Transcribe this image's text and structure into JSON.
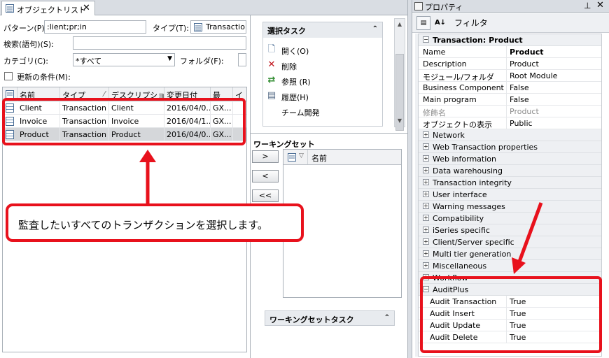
{
  "object_list": {
    "tab_title": "オブジェクトリスト",
    "tab_close": "✕",
    "pattern_label": "パターン(P):",
    "pattern_value": ":lient;pr;in",
    "type_label": "タイプ(T):",
    "type_value": "Transaction",
    "search_label": "検索(語句)(S):",
    "search_value": "",
    "category_label": "カテゴリ(C):",
    "category_value": "*すべて",
    "folder_label": "フォルダ(F):",
    "folder_value": "",
    "update_condition_label": "更新の条件(M):",
    "columns": [
      "名前",
      "タイプ",
      "デスクリプショ",
      "変更日付",
      "最",
      "イ"
    ],
    "rows": [
      {
        "name": "Client",
        "type": "Transaction",
        "description": "Client",
        "modified": "2016/04/0...",
        "last": "GX..."
      },
      {
        "name": "Invoice",
        "type": "Transaction",
        "description": "Invoice",
        "modified": "2016/04/1...",
        "last": "GX..."
      },
      {
        "name": "Product",
        "type": "Transaction",
        "description": "Product",
        "modified": "2016/04/0...",
        "last": "GX..."
      }
    ],
    "selected_tasks": {
      "title": "選択タスク",
      "items": [
        {
          "icon": "open-icon",
          "label": "開く(O)",
          "glyph": "🗋"
        },
        {
          "icon": "delete-icon",
          "label": "削除",
          "glyph": "✕"
        },
        {
          "icon": "references-icon",
          "label": "参照 (R)",
          "glyph": "⇄"
        },
        {
          "icon": "history-icon",
          "label": "履歴(H)",
          "glyph": "▤"
        },
        {
          "icon": "",
          "label": "チーム開発",
          "glyph": ""
        }
      ]
    },
    "working_set": {
      "title": "ワーキングセット",
      "add_button": ">",
      "remove_button": "<",
      "remove_all_button": "<<",
      "name_column": "名前",
      "tasks_title": "ワーキングセットタスク"
    }
  },
  "properties": {
    "title": "プロパティ",
    "filter_label": "フィルタ",
    "header": "Transaction: Product",
    "rows": [
      {
        "name": "Name",
        "value": "Product",
        "bold": true
      },
      {
        "name": "Description",
        "value": "Product"
      },
      {
        "name": "モジュール/フォルダ",
        "value": "Root Module"
      },
      {
        "name": "Business Component",
        "value": "False"
      },
      {
        "name": "Main program",
        "value": "False"
      },
      {
        "name": "修飾名",
        "value": "Product",
        "grey": true
      },
      {
        "name": "オブジェクトの表示",
        "value": "Public"
      }
    ],
    "categories": [
      "Network",
      "Web Transaction properties",
      "Web information",
      "Data warehousing",
      "Transaction integrity",
      "User interface",
      "Warning messages",
      "Compatibility",
      "iSeries specific",
      "Client/Server specific",
      "Multi tier generation",
      "Miscellaneous",
      "Workflow"
    ],
    "audit_plus": {
      "label": "AuditPlus",
      "rows": [
        {
          "name": "Audit Transaction",
          "value": "True"
        },
        {
          "name": "Audit Insert",
          "value": "True"
        },
        {
          "name": "Audit Update",
          "value": "True"
        },
        {
          "name": "Audit Delete",
          "value": "True"
        }
      ]
    }
  },
  "annotation": {
    "callout_text": "監査したいすべてのトランザクションを選択します。"
  },
  "colors": {
    "annotation_red": "#e8111c",
    "selected_row": "#d5d7da",
    "category_bg": "#eef0f3"
  }
}
